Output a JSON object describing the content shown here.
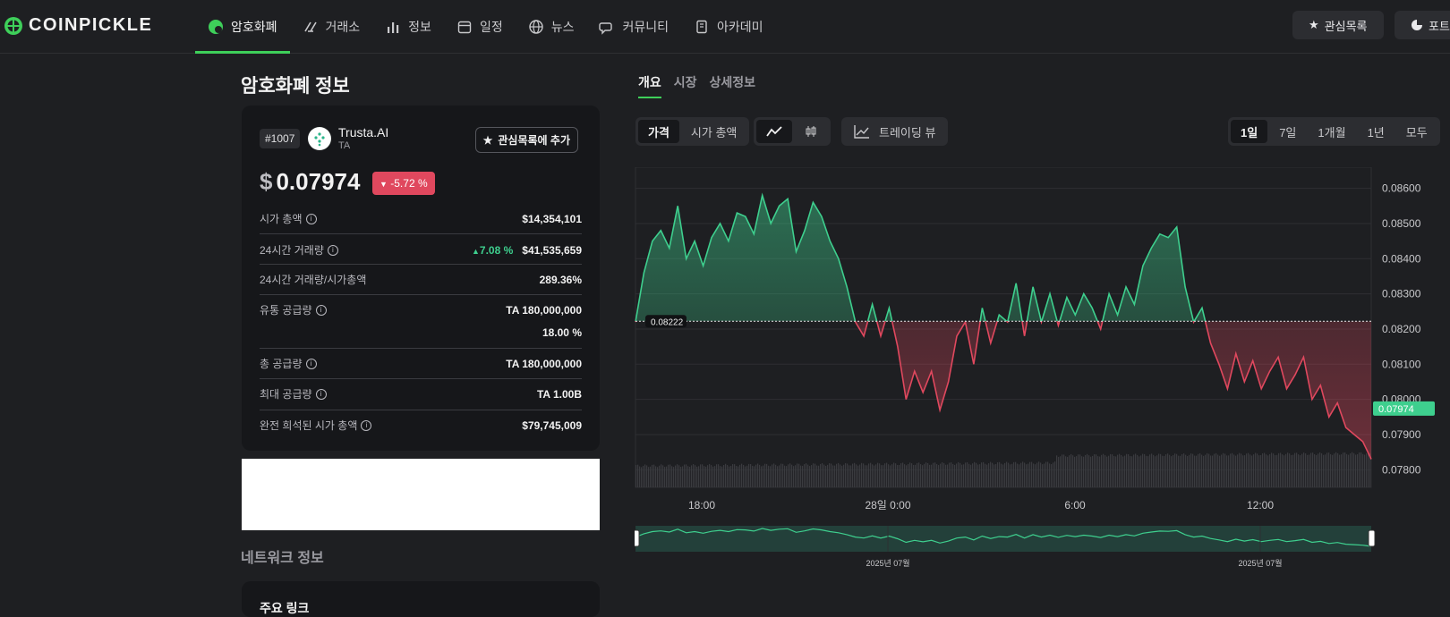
{
  "brand": {
    "name": "COINPICKLE",
    "accent": "#3ecf5a"
  },
  "nav": [
    {
      "label": "암호화폐",
      "icon": "coin-icon",
      "active": true
    },
    {
      "label": "거래소",
      "icon": "exchange-icon"
    },
    {
      "label": "정보",
      "icon": "bar-chart-icon"
    },
    {
      "label": "일정",
      "icon": "calendar-icon"
    },
    {
      "label": "뉴스",
      "icon": "globe-icon"
    },
    {
      "label": "커뮤니티",
      "icon": "chat-icon"
    },
    {
      "label": "아카데미",
      "icon": "book-icon"
    }
  ],
  "top_buttons": {
    "watchlist": "관심목록",
    "portfolio": "포트"
  },
  "page": {
    "title": "암호화폐 정보",
    "network_title": "네트워크 정보",
    "network_cut": "주요 링크"
  },
  "coin": {
    "rank": "#1007",
    "name": "Trusta.AI",
    "symbol": "TA",
    "watch_add": "관심목록에 추가",
    "price_currency": "$",
    "price": "0.07974",
    "change": "-5.72 %",
    "change_color": "#e0485e"
  },
  "stats": {
    "market_cap_label": "시가 총액",
    "market_cap": "$14,354,101",
    "volume_label": "24시간 거래량",
    "volume_change": "7.08 %",
    "volume": "$41,535,659",
    "vol_mcap_label": "24시간 거래량/시가총액",
    "vol_mcap": "289.36%",
    "circ_supply_label": "유통 공급량",
    "circ_supply": "TA 180,000,000",
    "circ_pct": "18.00 %",
    "total_supply_label": "총 공급량",
    "total_supply": "TA 180,000,000",
    "max_supply_label": "최대 공급량",
    "max_supply": "TA 1.00B",
    "fdv_label": "완전 희석된 시가 총액",
    "fdv": "$79,745,009"
  },
  "tabs": [
    "개요",
    "시장",
    "상세정보"
  ],
  "controls": {
    "mode": [
      "가격",
      "시가 총액"
    ],
    "trading_view": "트레이딩 뷰",
    "ranges": [
      "1일",
      "7일",
      "1개월",
      "1년",
      "모두"
    ]
  },
  "chart_data": {
    "type": "area",
    "title": "",
    "reference_price": 0.08222,
    "reference_label": "0.08222",
    "current_price": 0.07974,
    "current_label": "0.07974",
    "y_ticks": [
      "0.08600",
      "0.08500",
      "0.08400",
      "0.08300",
      "0.08200",
      "0.08100",
      "0.08000",
      "0.07900",
      "0.07800"
    ],
    "ylim": [
      0.0775,
      0.0866
    ],
    "x_ticks": [
      "18:00",
      "28일 0:00",
      "6:00",
      "12:00"
    ],
    "navigator_labels": [
      "2025년 07월",
      "2025년 07월"
    ],
    "up_color": "#3ecf8e",
    "down_color": "#e0485e",
    "y": [
      0.0822,
      0.0836,
      0.0845,
      0.0848,
      0.0843,
      0.0855,
      0.084,
      0.0845,
      0.0838,
      0.0846,
      0.085,
      0.0845,
      0.0853,
      0.0852,
      0.0847,
      0.0858,
      0.085,
      0.0855,
      0.0857,
      0.0842,
      0.0848,
      0.0856,
      0.0852,
      0.0845,
      0.084,
      0.0832,
      0.0822,
      0.0818,
      0.0827,
      0.0818,
      0.0826,
      0.0815,
      0.08,
      0.0808,
      0.0802,
      0.0808,
      0.0797,
      0.0805,
      0.0818,
      0.0822,
      0.081,
      0.0826,
      0.0816,
      0.0824,
      0.0822,
      0.0833,
      0.0818,
      0.0832,
      0.0822,
      0.083,
      0.0821,
      0.0829,
      0.0824,
      0.083,
      0.0826,
      0.082,
      0.083,
      0.0824,
      0.0832,
      0.0827,
      0.0838,
      0.0843,
      0.0847,
      0.0846,
      0.0849,
      0.0832,
      0.0822,
      0.0826,
      0.0816,
      0.081,
      0.0803,
      0.0813,
      0.0805,
      0.0811,
      0.0803,
      0.0808,
      0.0812,
      0.0803,
      0.0807,
      0.0812,
      0.08,
      0.0804,
      0.0795,
      0.0799,
      0.0792,
      0.079,
      0.0788,
      0.0783
    ]
  }
}
